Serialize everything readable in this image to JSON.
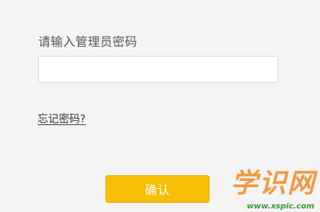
{
  "login": {
    "prompt": "请输入管理员密码",
    "password_value": "",
    "forgot_link": "忘记密码?",
    "confirm_label": "确认"
  },
  "watermark": {
    "logo_text": "学识网",
    "url": "www.xspic.com"
  },
  "colors": {
    "background": "#f4f4f4",
    "button": "#f7bf06",
    "watermark_logo": "#ee8a26",
    "watermark_url": "#3a9a3a"
  }
}
